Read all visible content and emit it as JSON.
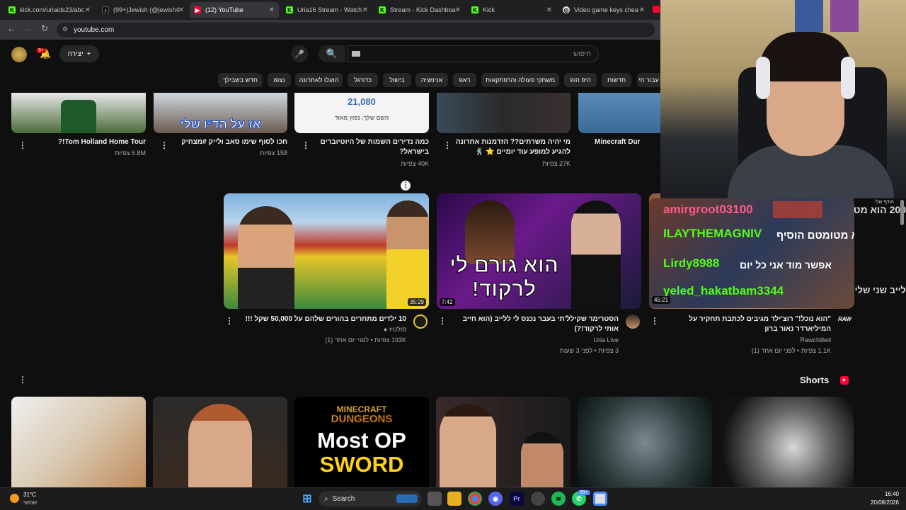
{
  "browser": {
    "tabs": [
      {
        "label": "kick.com/uriaids23/abc",
        "icon": "kick-icon"
      },
      {
        "label": "(99+)Jewish (@jewish4",
        "icon": "tiktok-icon"
      },
      {
        "label": "(12) YouTube",
        "icon": "youtube-icon",
        "active": true
      },
      {
        "label": "Uria16 Stream - Watch",
        "icon": "kick-icon"
      },
      {
        "label": "Stream - Kick Dashboa",
        "icon": "kick-icon"
      },
      {
        "label": "Kick",
        "icon": "kick-icon"
      },
      {
        "label": "Video game keys chea",
        "icon": "globe-icon"
      }
    ],
    "url": "youtube.com"
  },
  "yt": {
    "search_placeholder": "חיפוש",
    "create_label": "יצירה",
    "notif_count": "9+",
    "chips": [
      "עבור חי",
      "חדשות",
      "היפ הופ",
      "משחקי פעולה והרפתקאות",
      "ראפ",
      "אנימציה",
      "בישול",
      "כדורגל",
      "הועלו לאחרונה",
      "נצפו",
      "חדש בשבילך"
    ]
  },
  "row1": [
    {
      "title": "Tom Holland Home Tour!?",
      "meta": "6.8M צפיות"
    },
    {
      "title": "חכו לסוף שימו סאב ולייק #מצחיק",
      "meta": "158 צפיות",
      "thumb_text": "אז על הד*ו שלי"
    },
    {
      "title": "כמה נדירים השמות של היוטיוברים בישראל?",
      "meta": "40K צפיות",
      "thumb_num": "21,080",
      "thumb_label1": "השם שלך:",
      "thumb_label2": "השם שלך: נפוץ מאוד"
    },
    {
      "title": "מי יהיה משרתים?? הזדמנות אחרונה להגיע למופע עוד יומיים ⭐ 🕺",
      "meta": "27K צפיות"
    },
    {
      "title": "Minecraft Dur",
      "meta": ""
    }
  ],
  "row2": [
    {
      "title": "10 ילדים מתחרים בהורים שלהם על 50,000 שקל !!!",
      "channel": "סולטיז",
      "meta": "193K צפיות • לפני יום אחד (1)",
      "duration": "35:29"
    },
    {
      "title": "הסטרימר שקילל'תי בעבר נכנס לי ללייב (הוא חייב אותי לרקוד!?)",
      "channel": "Uria Live",
      "meta": "3 צפיות • לפני 3 שעות",
      "duration": "7:42",
      "thumb_text": "הוא גורם לי לרקוד!"
    },
    {
      "title": "\"הוא נוכל!\" רוצ'ילד מגיבים לכתבת תחקיר על המיליארדר נאור ברון",
      "channel": "Rawchilled",
      "meta": "1.1K צפיות • לפני יום אחד (1)",
      "duration": "45:21",
      "channel_badge": "RAW"
    }
  ],
  "chat_overlay": {
    "header": "הודף שלי",
    "lines": [
      "amirgroot03100",
      "ILAYTHEMAGNIV",
      "200 הוא מטומטם הוסיף",
      "Lirdy8988",
      "אפשר מוד אני כל יום",
      "לייב שני שלי",
      "yeled_hakatbam3344",
      "הוא נוכל"
    ]
  },
  "shorts": {
    "title": "Shorts",
    "minecraft_top": "MINECRAFT",
    "minecraft_mid": "DUNGEONS",
    "minecraft_l1": "Most OP",
    "minecraft_l2": "SWORD"
  },
  "taskbar": {
    "temp": "31°C",
    "weather": "שמשי",
    "search": "Search",
    "time": "16:40",
    "date": "20/08/2026",
    "badge": "99+"
  },
  "colors": {
    "accent_red": "#ff0033",
    "kick_green": "#53fc18",
    "chip_bg": "#272727"
  }
}
